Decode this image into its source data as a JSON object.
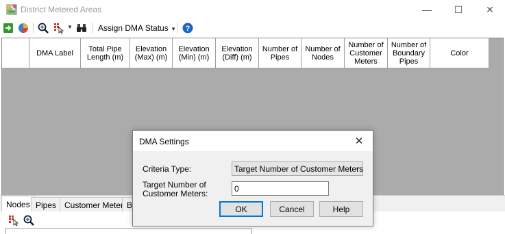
{
  "window": {
    "title": "District Metered Areas",
    "minimize_glyph": "—",
    "maximize_glyph": "☐",
    "close_glyph": "✕"
  },
  "toolbar": {
    "assign_status_label": "Assign DMA Status",
    "icons": [
      "export-arrow-icon",
      "pie-chart-icon",
      "zoom-in-icon",
      "select-grid-icon",
      "binoculars-icon",
      "help-icon"
    ]
  },
  "grid": {
    "columns": [
      "",
      "DMA Label",
      "Total Pipe Length (m)",
      "Elevation (Max) (m)",
      "Elevation (Min) (m)",
      "Elevation (Diff) (m)",
      "Number of Pipes",
      "Number of Nodes",
      "Number of Customer Meters",
      "Number of Boundary Pipes",
      "Color"
    ],
    "rows": []
  },
  "bottom_tabs": [
    "Nodes",
    "Pipes",
    "Customer Meters",
    "Bo"
  ],
  "dialog": {
    "title": "DMA Settings",
    "close_glyph": "✕",
    "criteria_label": "Criteria Type:",
    "criteria_value": "Target Number of Customer Meters",
    "target_label_line1": "Target Number of",
    "target_label_line2": "Customer Meters:",
    "target_value": "0",
    "ok_label": "OK",
    "cancel_label": "Cancel",
    "help_label": "Help"
  },
  "colors": {
    "accent": "#0078d7",
    "grid_background": "#ababab",
    "help_icon": "#1e64c8",
    "export_icon": "#2e9a2e"
  }
}
